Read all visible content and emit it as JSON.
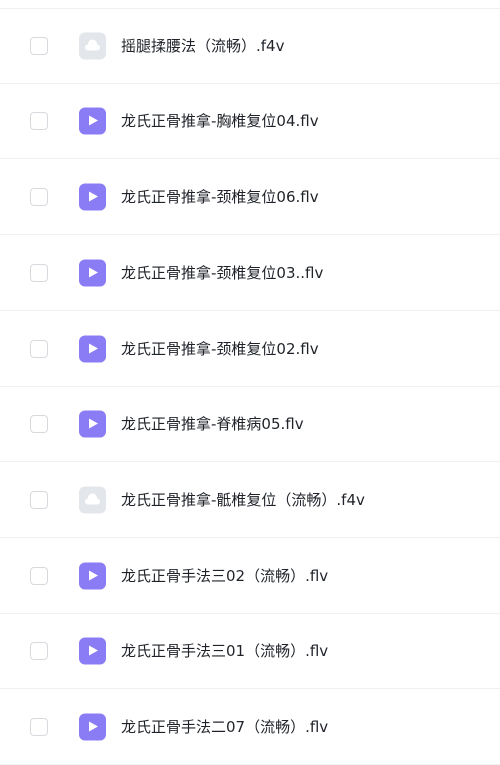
{
  "files": [
    {
      "name": "摇腿揉腰法（流畅）.f4v",
      "icon": "cloud-file-icon",
      "checked": false
    },
    {
      "name": "龙氏正骨推拿-胸椎复位04.flv",
      "icon": "video-file-icon",
      "checked": false
    },
    {
      "name": "龙氏正骨推拿-颈椎复位06.flv",
      "icon": "video-file-icon",
      "checked": false
    },
    {
      "name": "龙氏正骨推拿-颈椎复位03..flv",
      "icon": "video-file-icon",
      "checked": false
    },
    {
      "name": "龙氏正骨推拿-颈椎复位02.flv",
      "icon": "video-file-icon",
      "checked": false
    },
    {
      "name": "龙氏正骨推拿-脊椎病05.flv",
      "icon": "video-file-icon",
      "checked": false
    },
    {
      "name": "龙氏正骨推拿-骶椎复位（流畅）.f4v",
      "icon": "cloud-file-icon",
      "checked": false
    },
    {
      "name": "龙氏正骨手法三02（流畅）.flv",
      "icon": "video-file-icon",
      "checked": false
    },
    {
      "name": "龙氏正骨手法三01（流畅）.flv",
      "icon": "video-file-icon",
      "checked": false
    },
    {
      "name": "龙氏正骨手法二07（流畅）.flv",
      "icon": "video-file-icon",
      "checked": false
    }
  ],
  "colors": {
    "video_icon": "#8a7cf5",
    "cloud_icon": "#e3e6ea",
    "text": "#1f2329",
    "divider": "#eef0f3",
    "checkbox_border": "#d7d9de"
  }
}
